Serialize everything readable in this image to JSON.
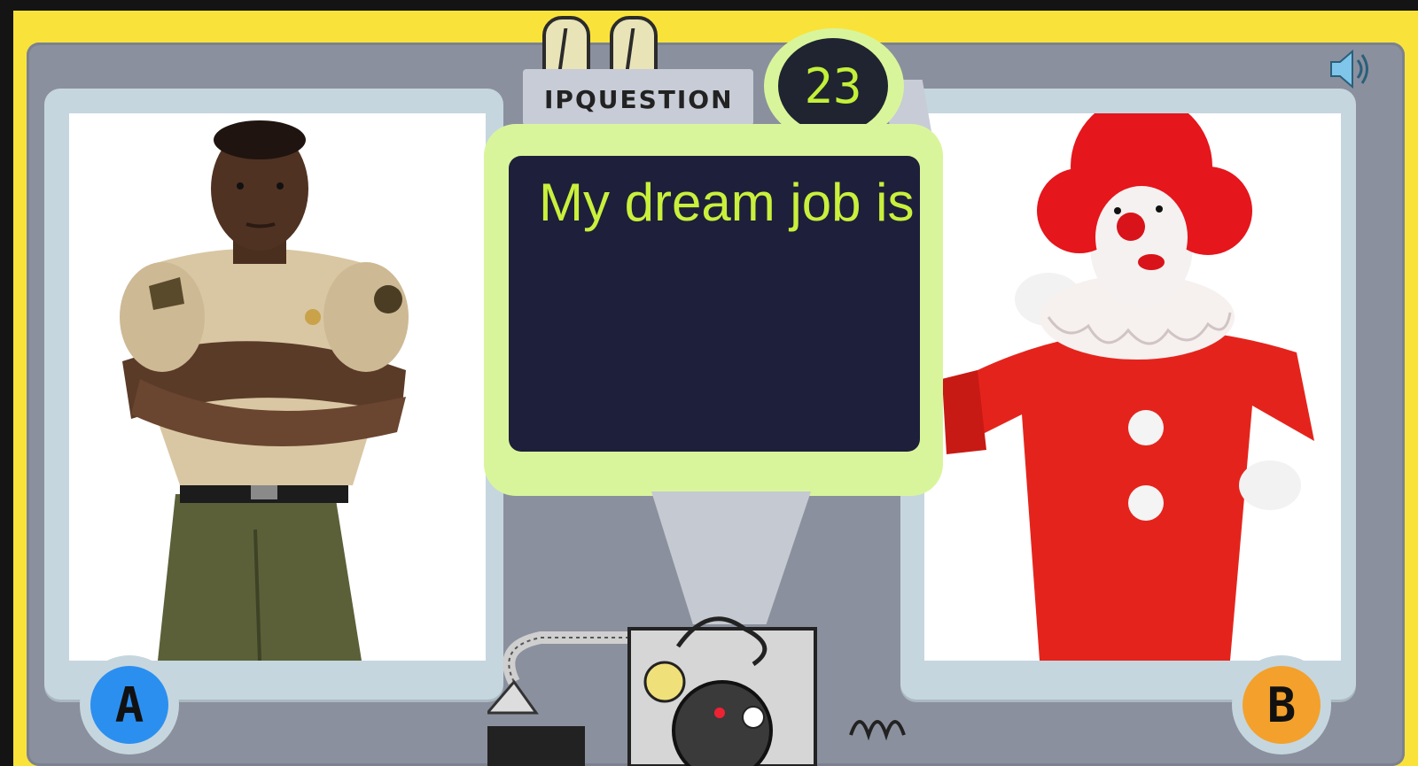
{
  "header": {
    "label": "IPQUESTION",
    "question_number": "23"
  },
  "question": {
    "text": "My dream job is"
  },
  "options": [
    {
      "letter": "A",
      "color": "#2b8ff0",
      "image": "police-officer-photo"
    },
    {
      "letter": "B",
      "color": "#f3a12c",
      "image": "clown-photo"
    }
  ],
  "controls": {
    "sound_icon": "speaker-icon"
  },
  "colors": {
    "frame": "#f9e33a",
    "panel": "#8b909e",
    "screen": "#1e1f3a",
    "screen_text": "#c9f03c",
    "bezel": "#d9f59c"
  }
}
